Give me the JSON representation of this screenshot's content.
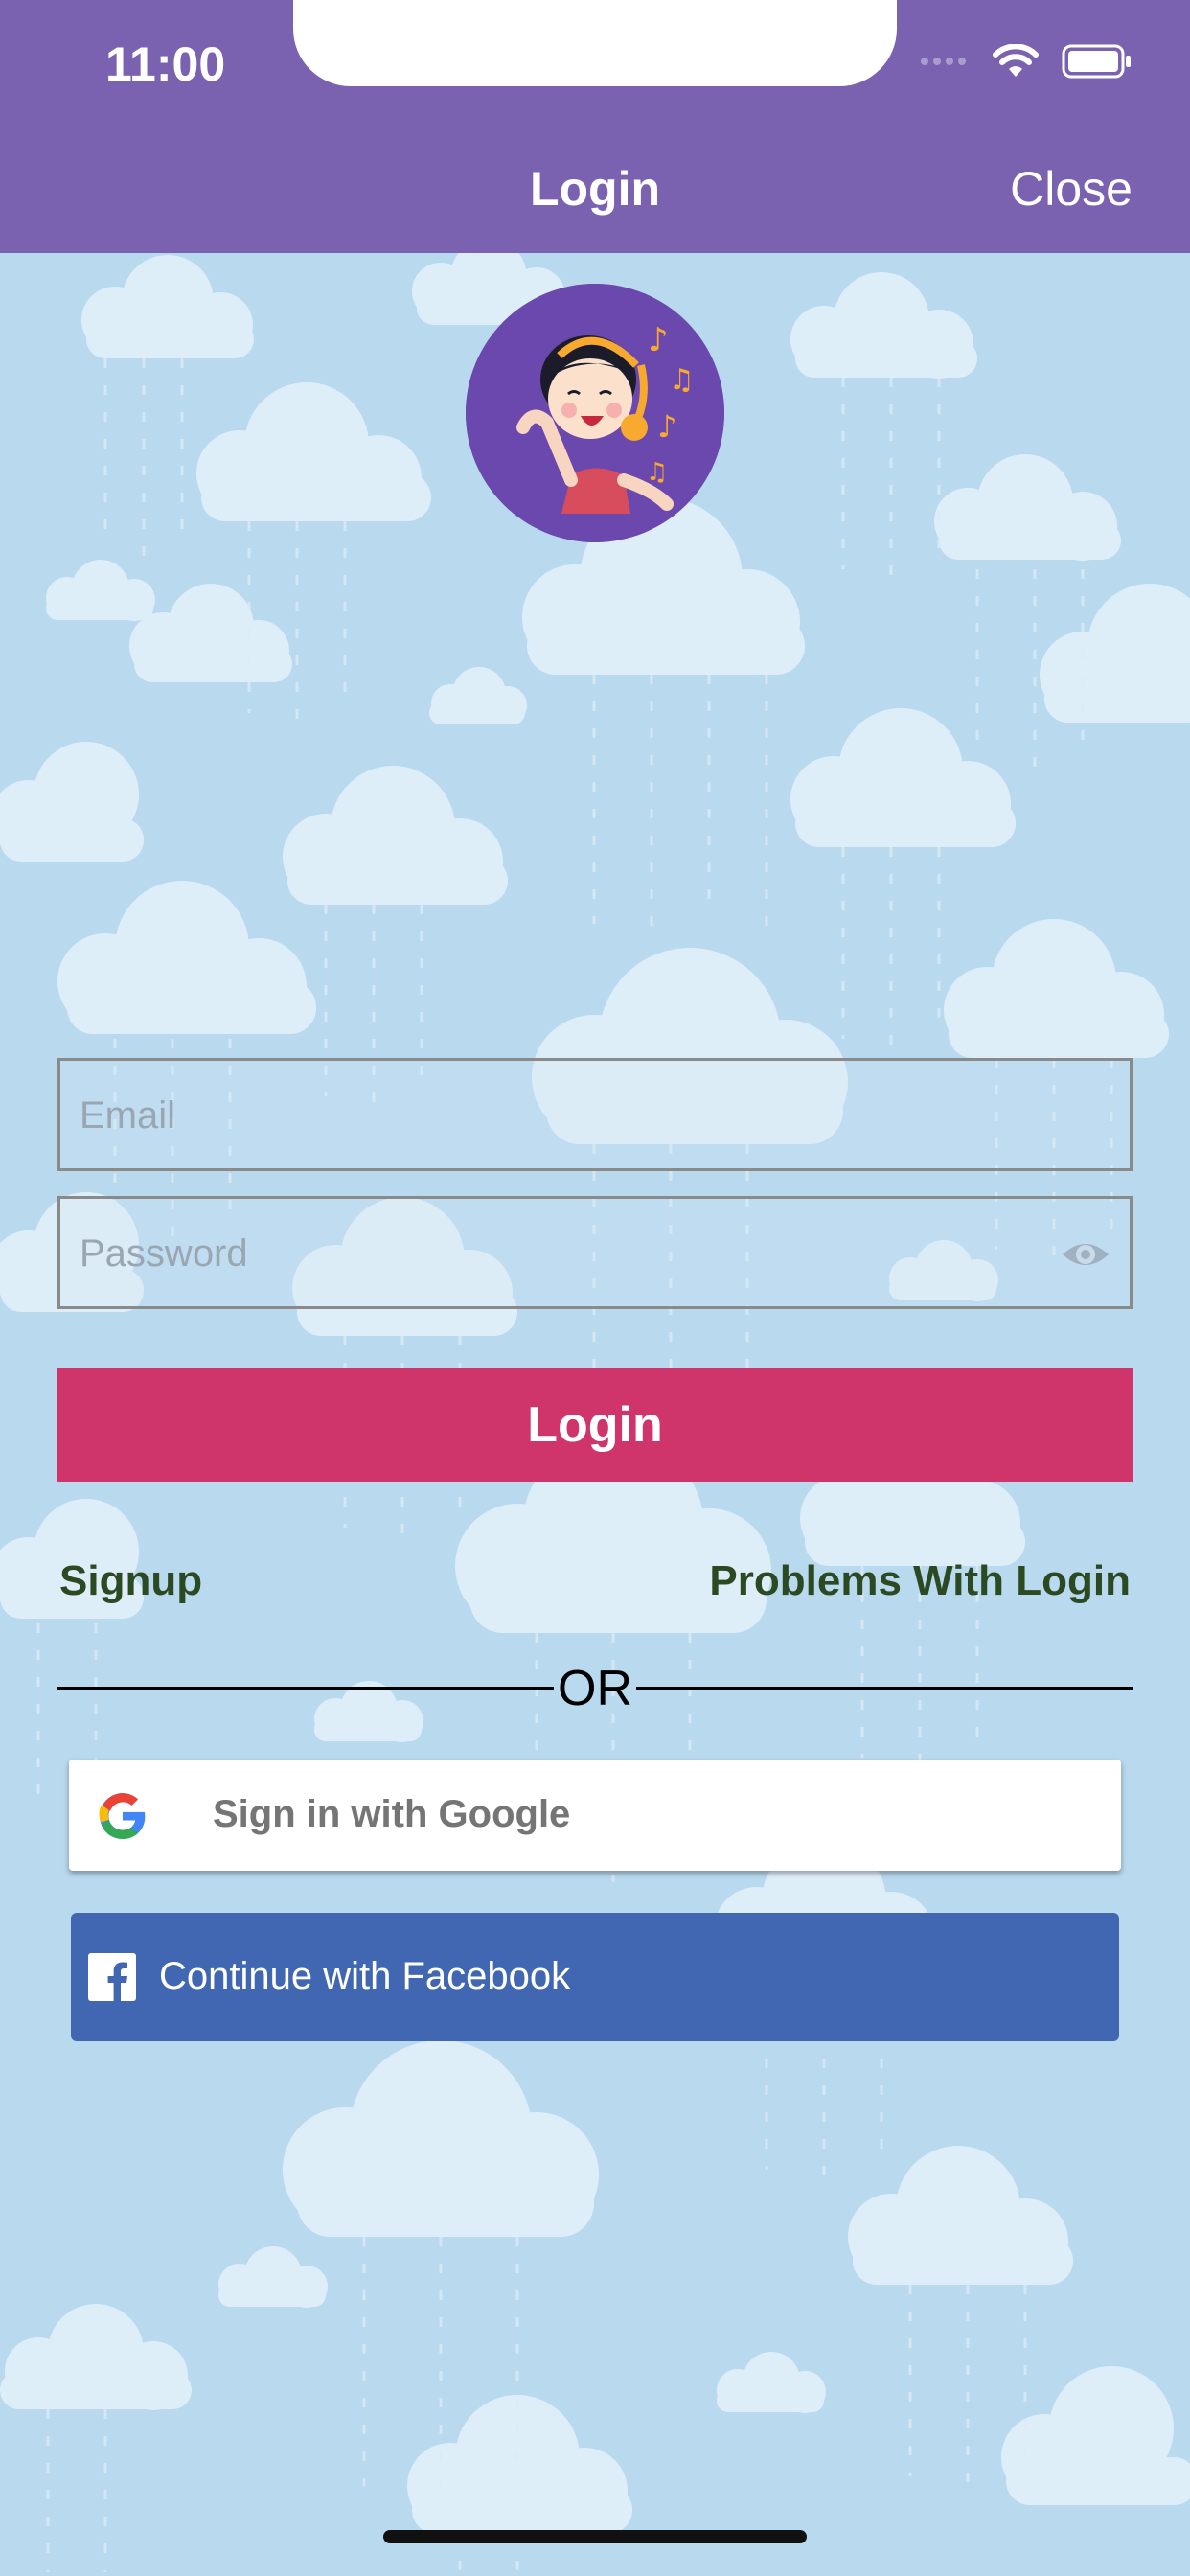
{
  "status_bar": {
    "time": "11:00"
  },
  "header": {
    "title": "Login",
    "close_label": "Close"
  },
  "avatar": {
    "icon": "singing-girl-logo"
  },
  "form": {
    "email": {
      "placeholder": "Email",
      "value": ""
    },
    "password": {
      "placeholder": "Password",
      "value": ""
    },
    "login_label": "Login"
  },
  "links": {
    "signup": "Signup",
    "problems": "Problems With Login"
  },
  "divider": {
    "text": "OR"
  },
  "social": {
    "google_label": "Sign in with Google",
    "facebook_label": "Continue with Facebook"
  },
  "colors": {
    "header": "#7b62b1",
    "background": "#b9d9ef",
    "login_button": "#cf356b",
    "link_text": "#2c4a22",
    "facebook": "#4267b2"
  }
}
